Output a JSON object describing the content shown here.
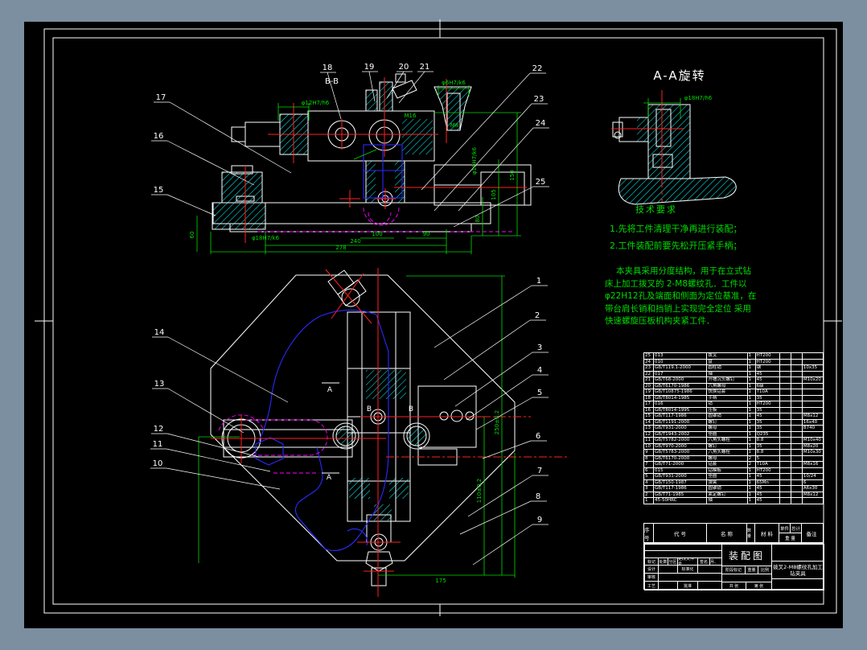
{
  "colors": {
    "background": "#7b8fa1",
    "canvas": "#000000",
    "outline": "#ffffff",
    "hatch": "#00ffff",
    "centerline": "#ff2020",
    "dimension": "#00dd00",
    "workpiece": "#2a2aff",
    "hidden": "#ff00ff"
  },
  "views": {
    "bb": "B-B",
    "aa": "A-A旋转",
    "a": "A",
    "b": "B"
  },
  "balloons": [
    "1",
    "2",
    "3",
    "4",
    "5",
    "6",
    "7",
    "8",
    "9",
    "10",
    "11",
    "12",
    "13",
    "14",
    "15",
    "16",
    "17",
    "18",
    "19",
    "20",
    "21",
    "22",
    "23",
    "24",
    "25"
  ],
  "dims": {
    "top": {
      "collar": "φ12H7/h6",
      "bush_top": "φ6H7/k6",
      "m16": "M16",
      "m8": "M8",
      "side": "φ10H7/k6",
      "v150": "150",
      "v105": "105",
      "v80": "80",
      "left60": "60",
      "base_phi": "φ18H7/k6",
      "b100": "100",
      "b90": "90",
      "b240": "240",
      "b278": "278"
    },
    "aa": {
      "phi": "φ18H7/h6"
    },
    "plan": {
      "b175": "175",
      "v250": "250±0.2",
      "v110": "110±0.2"
    }
  },
  "tech": {
    "title": "技术要求",
    "items": [
      "1.先将工件清理干净再进行装配；",
      "2.工件装配前要先松开压紧手柄；"
    ]
  },
  "desc": {
    "lines": [
      "本夹具采用分度结构，用于在立式钻",
      "床上加工拨叉的 2-M8螺纹孔．工件以",
      "φ22H12孔及端面和侧面为定位基准，在",
      "带台肩长销和挡销上实现完全定位  采用",
      "快速螺旋压板机构夹紧工件．"
    ]
  },
  "bom": {
    "headers": {
      "seq": "序号",
      "code": "代 号",
      "name": "名 称",
      "qty": "数量",
      "mat": "材 料",
      "unit": "单件",
      "total": "总计",
      "weight": "重 量",
      "remark": "备注"
    },
    "rows": [
      [
        "25",
        "013",
        "拨叉",
        "1",
        "HT200",
        "",
        "",
        ""
      ],
      [
        "24",
        "010",
        "盘",
        "1",
        "HT200",
        "",
        "",
        ""
      ],
      [
        "23",
        "GB/T119.1-2000",
        "圆柱销",
        "1",
        "钢",
        "",
        "",
        "10x35"
      ],
      [
        "22",
        "017",
        "轴",
        "1",
        "45",
        "",
        "",
        ""
      ],
      [
        "21",
        "GB/T68-2000",
        "开槽沉头螺钉",
        "1",
        "45",
        "",
        "",
        "M10x20"
      ],
      [
        "20",
        "GB/T6170-1986",
        "六角螺母",
        "1",
        "6级",
        "",
        "",
        ""
      ],
      [
        "19",
        "GB/T10875-1986",
        "快换钻套",
        "1",
        "T10A",
        "",
        "",
        ""
      ],
      [
        "18",
        "GB/T8014-1985",
        "手柄",
        "1",
        "35",
        "",
        "",
        ""
      ],
      [
        "17",
        "016",
        "销",
        "1",
        "HT200",
        "",
        "",
        ""
      ],
      [
        "16",
        "GB/T8014-1995",
        "压板",
        "1",
        "35",
        "",
        "",
        ""
      ],
      [
        "15",
        "GB/T117-1986",
        "圆锥销",
        "1",
        "45",
        "",
        "",
        "M8x12"
      ],
      [
        "14",
        "GB/T1191-2000",
        "螺钉",
        "1",
        "35",
        "",
        "",
        "16x40"
      ],
      [
        "13",
        "GB/T931-2000",
        "螺母",
        "1",
        "35",
        "",
        "",
        "B740"
      ],
      [
        "12",
        "GB/T1943-2002",
        "垫圈",
        "1",
        "Q235",
        "",
        "",
        ""
      ],
      [
        "11",
        "GB/T5782-2000",
        "六角头螺栓",
        "1",
        "8.8",
        "",
        "",
        "M10x40"
      ],
      [
        "10",
        "GB/T970-2000",
        "螺钉",
        "1",
        "35",
        "",
        "",
        "M8x20"
      ],
      [
        "9",
        "GB/T5783-2000",
        "六角头螺栓",
        "1",
        "8.8",
        "",
        "",
        "M10x30"
      ],
      [
        "8",
        "GB/T6170-2000",
        "螺母",
        "2",
        "5",
        "",
        "",
        ""
      ],
      [
        "7",
        "GB/T71-2000",
        "钻套",
        "2",
        "T10A",
        "",
        "",
        "M8x16"
      ],
      [
        "6",
        "015",
        "钻模板",
        "1",
        "HT200",
        "",
        "",
        ""
      ],
      [
        "5",
        "GB/T931-2000",
        "垫圈",
        "1",
        "45",
        "",
        "",
        "10/24"
      ],
      [
        "4",
        "GB/T150-1987",
        "弹簧",
        "1",
        "65Mn",
        "",
        "",
        "6"
      ],
      [
        "3",
        "GB/T117-1986",
        "圆锥销",
        "1",
        "45",
        "",
        "",
        "A6x30"
      ],
      [
        "2",
        "GB/T71-1985",
        "紧定螺钉",
        "1",
        "45",
        "",
        "",
        "M8x12"
      ],
      [
        "1",
        "45-50HRC",
        "轴",
        "1",
        "45",
        "",
        "",
        ""
      ]
    ]
  },
  "title_block": {
    "name": "装配图",
    "title": "拨叉2-M8螺纹孔加工钻夹具",
    "r1": [
      "标记",
      "处数",
      "分区",
      "更改文件号",
      "签名",
      "年、月、日"
    ],
    "design": "设计",
    "standard": "标准化",
    "review": "审核",
    "process": "工艺",
    "approve": "批准",
    "stage": "阶段标记",
    "weight": "重量",
    "scale": "比例",
    "sheets": "共 张",
    "sheet": "第 张"
  }
}
